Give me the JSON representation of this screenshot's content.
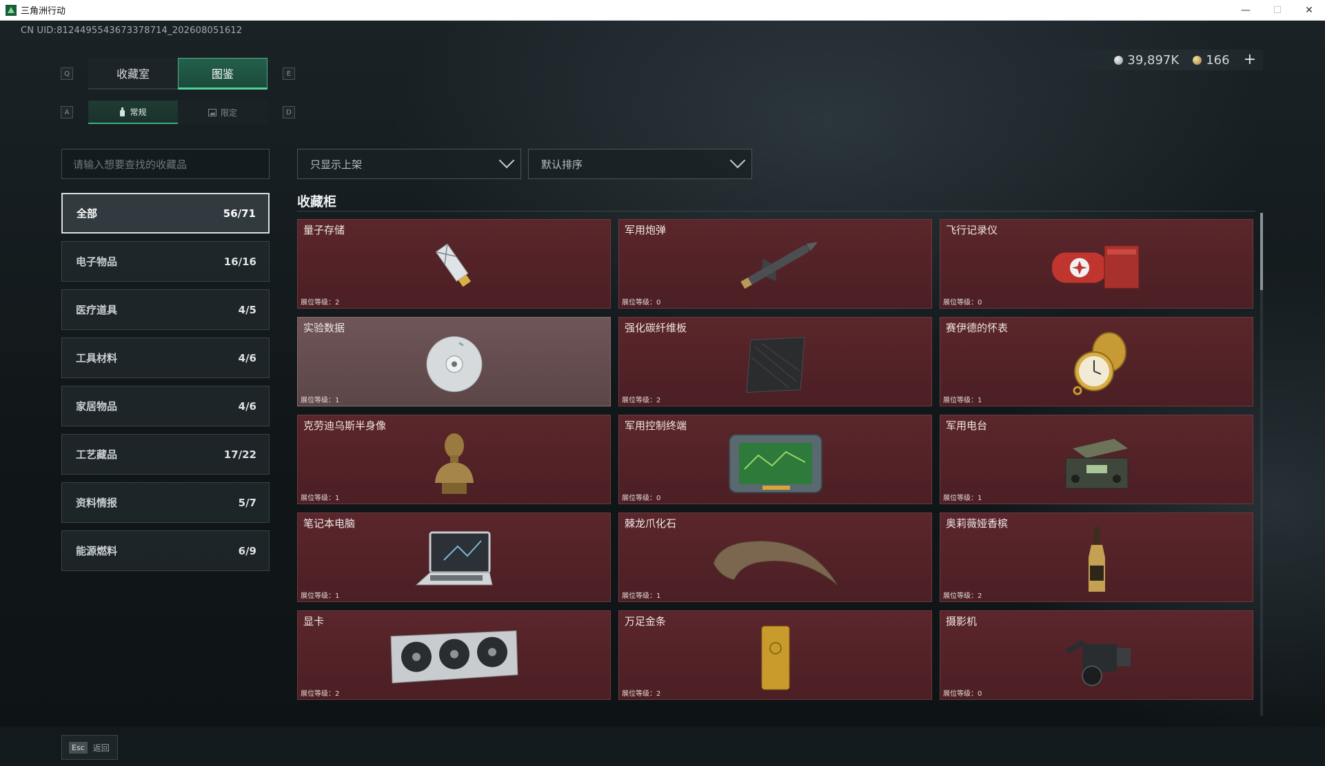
{
  "window": {
    "title": "三角洲行动",
    "controls": {
      "minimize": "—",
      "maximize": "☐",
      "close": "✕"
    }
  },
  "header": {
    "uid": "CN UID:8124495543673378714_202608051612",
    "currency": {
      "silver": "39,897K",
      "gold": "166",
      "plus": "+"
    }
  },
  "keys": {
    "q": "Q",
    "e": "E",
    "a": "A",
    "d": "D"
  },
  "tabs_main": [
    {
      "label": "收藏室"
    },
    {
      "label": "图鉴"
    }
  ],
  "tabs_sub": [
    {
      "label": "常规"
    },
    {
      "label": "限定"
    }
  ],
  "search": {
    "placeholder": "请输入想要查找的收藏品"
  },
  "filters": {
    "display": "只显示上架",
    "sort": "默认排序"
  },
  "categories": [
    {
      "label": "全部",
      "count": "56/71"
    },
    {
      "label": "电子物品",
      "count": "16/16"
    },
    {
      "label": "医疗道具",
      "count": "4/5"
    },
    {
      "label": "工具材料",
      "count": "4/6"
    },
    {
      "label": "家居物品",
      "count": "4/6"
    },
    {
      "label": "工艺藏品",
      "count": "17/22"
    },
    {
      "label": "资料情报",
      "count": "5/7"
    },
    {
      "label": "能源燃料",
      "count": "6/9"
    }
  ],
  "section": {
    "title": "收藏柜"
  },
  "items": [
    {
      "name": "量子存储",
      "level": "展位等级：2"
    },
    {
      "name": "军用炮弹",
      "level": "展位等级：0"
    },
    {
      "name": "飞行记录仪",
      "level": "展位等级：0"
    },
    {
      "name": "实验数据",
      "level": "展位等级：1"
    },
    {
      "name": "强化碳纤维板",
      "level": "展位等级：2"
    },
    {
      "name": "赛伊德的怀表",
      "level": "展位等级：1"
    },
    {
      "name": "克劳迪乌斯半身像",
      "level": "展位等级：1"
    },
    {
      "name": "军用控制终端",
      "level": "展位等级：0"
    },
    {
      "name": "军用电台",
      "level": "展位等级：1"
    },
    {
      "name": "笔记本电脑",
      "level": "展位等级：1"
    },
    {
      "name": "棘龙爪化石",
      "level": "展位等级：1"
    },
    {
      "name": "奥莉薇娅香槟",
      "level": "展位等级：2"
    },
    {
      "name": "显卡",
      "level": "展位等级：2"
    },
    {
      "name": "万足金条",
      "level": "展位等级：2"
    },
    {
      "name": "摄影机",
      "level": "展位等级：0"
    }
  ],
  "footer": {
    "esc_key": "Esc",
    "back_label": "返回"
  }
}
